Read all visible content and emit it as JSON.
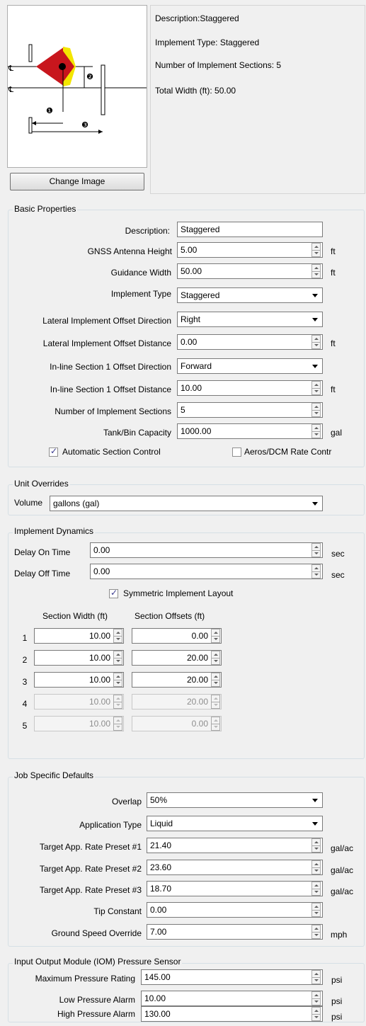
{
  "summary": {
    "description": "Description:Staggered",
    "implement_type": "Implement Type: Staggered",
    "sections": "Number of Implement Sections: 5",
    "total_width": "Total Width (ft): 50.00",
    "change_image_label": "Change Image",
    "diagram_markers": [
      "❶",
      "❷",
      "❸"
    ]
  },
  "basic": {
    "title": "Basic Properties",
    "description_label": "Description:",
    "description_value": "Staggered",
    "gnss_label": "GNSS Antenna Height",
    "gnss_value": "5.00",
    "gnss_unit": "ft",
    "guidance_label": "Guidance Width",
    "guidance_value": "50.00",
    "guidance_unit": "ft",
    "impl_type_label": "Implement Type",
    "impl_type_value": "Staggered",
    "lat_dir_label": "Lateral Implement Offset Direction",
    "lat_dir_value": "Right",
    "lat_dist_label": "Lateral Implement Offset Distance",
    "lat_dist_value": "0.00",
    "lat_dist_unit": "ft",
    "inline_dir_label": "In-line Section 1 Offset Direction",
    "inline_dir_value": "Forward",
    "inline_dist_label": "In-line Section 1 Offset Distance",
    "inline_dist_value": "10.00",
    "inline_dist_unit": "ft",
    "num_sections_label": "Number of Implement Sections",
    "num_sections_value": "5",
    "tank_label": "Tank/Bin Capacity",
    "tank_value": "1000.00",
    "tank_unit": "gal",
    "auto_section_label": "Automatic Section Control",
    "auto_section_checked": true,
    "aeros_label": "Aeros/DCM  Rate Contr",
    "aeros_checked": false
  },
  "units": {
    "title": "Unit Overrides",
    "volume_label": "Volume",
    "volume_value": "gallons  (gal)"
  },
  "dynamics": {
    "title": "Implement Dynamics",
    "delay_on_label": "Delay On Time",
    "delay_on_value": "0.00",
    "delay_on_unit": "sec",
    "delay_off_label": "Delay Off Time",
    "delay_off_value": "0.00",
    "delay_off_unit": "sec",
    "symmetric_label": "Symmetric Implement Layout",
    "symmetric_checked": true,
    "col_width": "Section Width (ft)",
    "col_offsets": "Section Offsets (ft)",
    "rows": [
      {
        "index": "1",
        "width": "10.00",
        "offset": "0.00",
        "enabled": true
      },
      {
        "index": "2",
        "width": "10.00",
        "offset": "20.00",
        "enabled": true
      },
      {
        "index": "3",
        "width": "10.00",
        "offset": "20.00",
        "enabled": true
      },
      {
        "index": "4",
        "width": "10.00",
        "offset": "20.00",
        "enabled": false
      },
      {
        "index": "5",
        "width": "10.00",
        "offset": "0.00",
        "enabled": false
      }
    ]
  },
  "job": {
    "title": "Job Specific Defaults",
    "overlap_label": "Overlap",
    "overlap_value": "50%",
    "app_type_label": "Application Type",
    "app_type_value": "Liquid",
    "preset1_label": "Target App. Rate Preset #1",
    "preset1_value": "21.40",
    "preset2_label": "Target App. Rate Preset #2",
    "preset2_value": "23.60",
    "preset3_label": "Target App. Rate Preset #3",
    "preset3_value": "18.70",
    "rate_unit": "gal/ac",
    "tip_label": "Tip Constant",
    "tip_value": "0.00",
    "speed_label": "Ground Speed Override",
    "speed_value": "7.00",
    "speed_unit": "mph"
  },
  "iom": {
    "title": "Input Output Module (IOM) Pressure Sensor",
    "max_label": "Maximum Pressure Rating",
    "max_value": "145.00",
    "low_label": "Low Pressure Alarm",
    "low_value": "10.00",
    "high_label": "High Pressure Alarm",
    "high_value": "130.00",
    "unit": "psi"
  }
}
